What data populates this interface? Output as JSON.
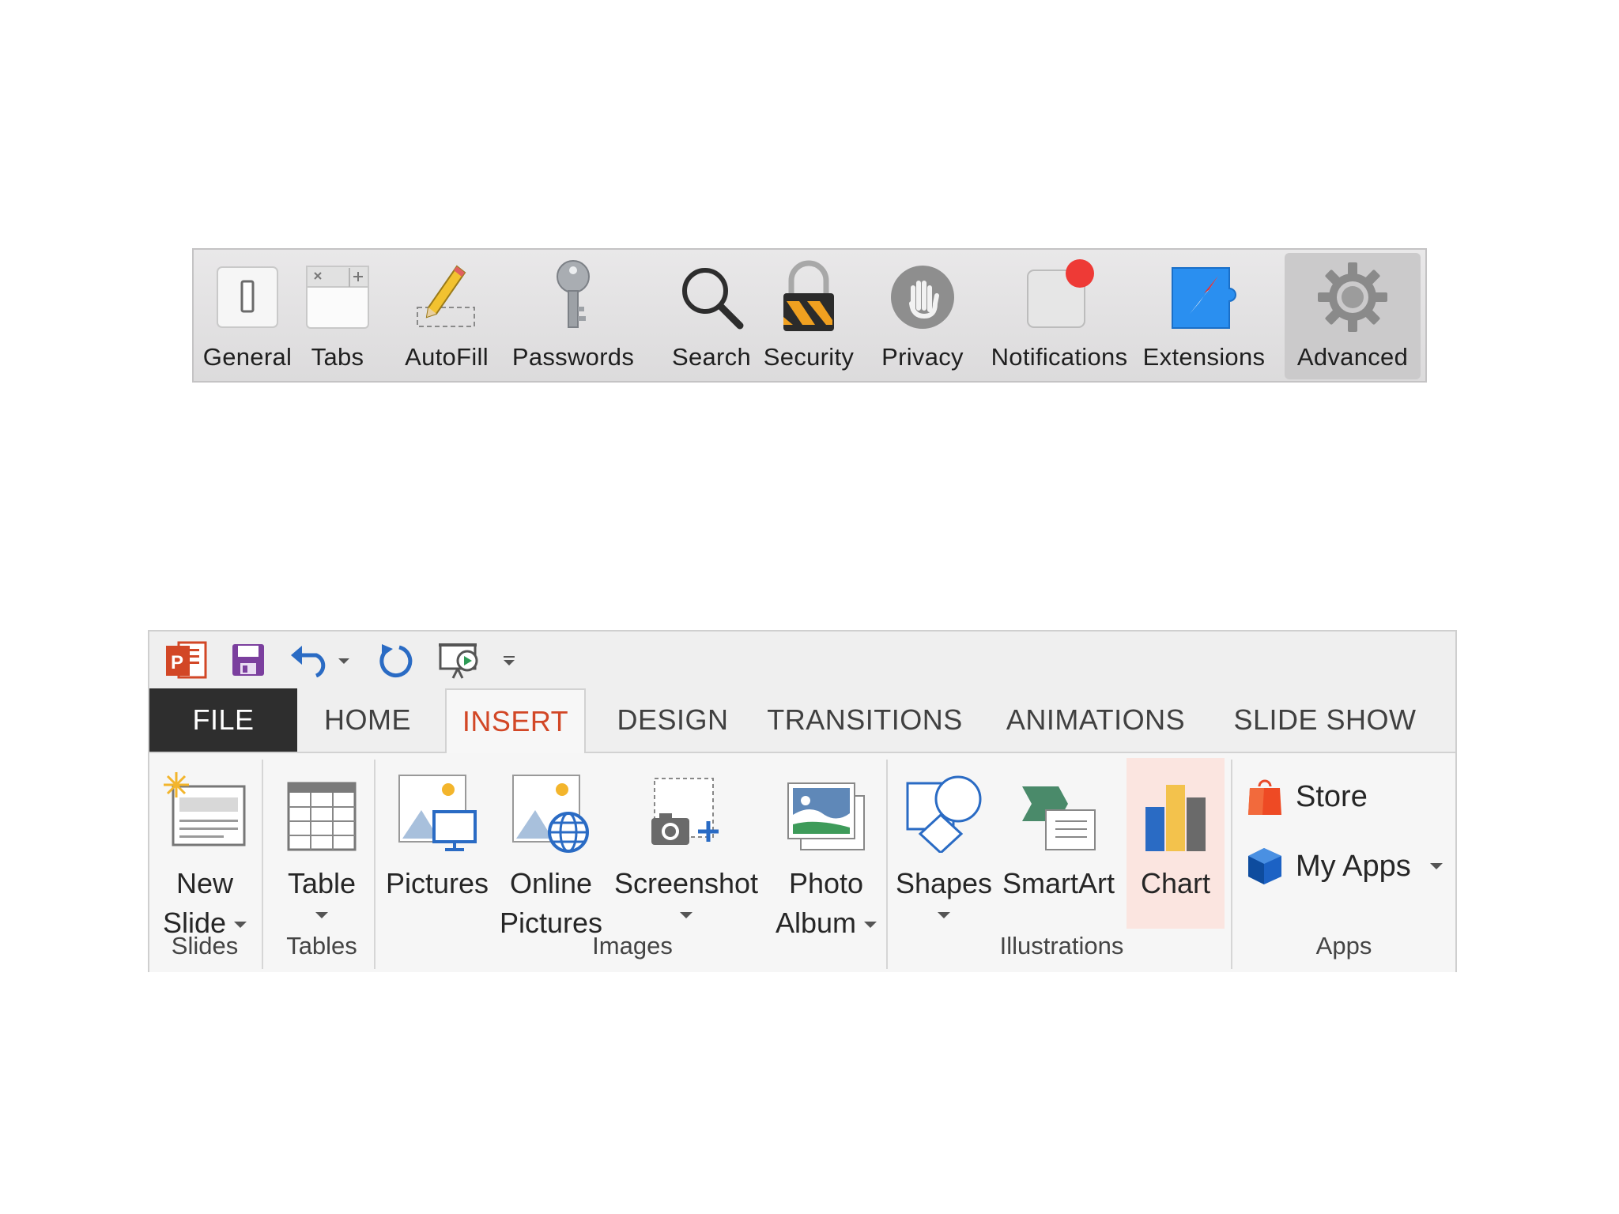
{
  "safari_toolbar": {
    "items": [
      {
        "label": "General",
        "icon": "general-switch-icon"
      },
      {
        "label": "Tabs",
        "icon": "tabs-icon"
      },
      {
        "label": "AutoFill",
        "icon": "pencil-icon"
      },
      {
        "label": "Passwords",
        "icon": "key-icon"
      },
      {
        "label": "Search",
        "icon": "magnifier-icon"
      },
      {
        "label": "Security",
        "icon": "padlock-icon"
      },
      {
        "label": "Privacy",
        "icon": "hand-icon"
      },
      {
        "label": "Notifications",
        "icon": "notification-badge-icon"
      },
      {
        "label": "Extensions",
        "icon": "puzzle-compass-icon"
      },
      {
        "label": "Advanced",
        "icon": "gear-icon"
      }
    ],
    "selected": "Advanced"
  },
  "powerpoint": {
    "quick_access": {
      "app_icon": "powerpoint-logo-icon",
      "save_icon": "save-icon",
      "undo_icon": "undo-icon",
      "redo_icon": "redo-icon",
      "presentation_icon": "start-slideshow-icon",
      "customize_icon": "customize-qat-icon"
    },
    "tabs": [
      {
        "label": "FILE"
      },
      {
        "label": "HOME"
      },
      {
        "label": "INSERT"
      },
      {
        "label": "DESIGN"
      },
      {
        "label": "TRANSITIONS"
      },
      {
        "label": "ANIMATIONS"
      },
      {
        "label": "SLIDE SHOW"
      }
    ],
    "active_tab": "INSERT",
    "groups": {
      "slides": {
        "label": "Slides",
        "new_slide": {
          "line1": "New",
          "line2": "Slide"
        }
      },
      "tables": {
        "label": "Tables",
        "table": {
          "line1": "Table"
        }
      },
      "images": {
        "label": "Images",
        "pictures": {
          "line1": "Pictures"
        },
        "online_pictures": {
          "line1": "Online",
          "line2": "Pictures"
        },
        "screenshot": {
          "line1": "Screenshot"
        },
        "photo_album": {
          "line1": "Photo",
          "line2": "Album"
        }
      },
      "illustrations": {
        "label": "Illustrations",
        "shapes": {
          "line1": "Shapes"
        },
        "smartart": {
          "line1": "SmartArt"
        },
        "chart": {
          "line1": "Chart"
        }
      },
      "apps": {
        "label": "Apps",
        "store": "Store",
        "my_apps": "My Apps"
      }
    },
    "colors": {
      "accent": "#d24726",
      "file_tab_bg": "#2e2e2e",
      "chart_highlight": "#fbe5e0"
    }
  }
}
